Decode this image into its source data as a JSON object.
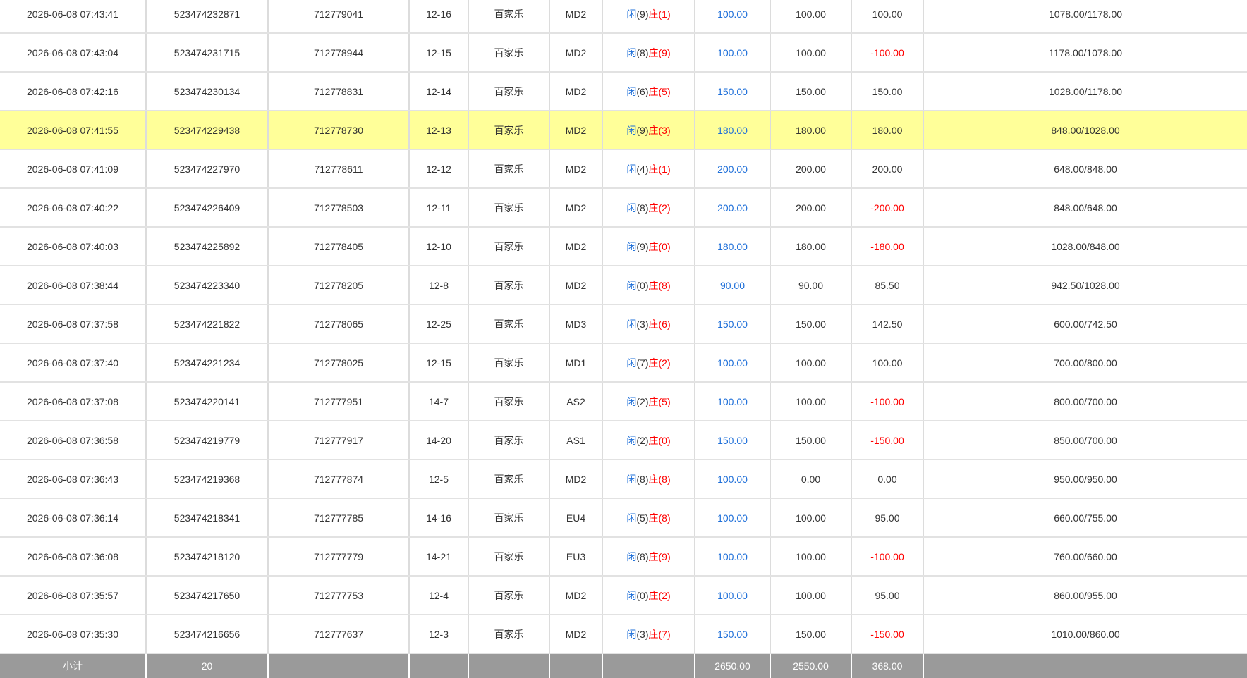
{
  "colors": {
    "highlight_row": "#ffff99",
    "blue_text": "#1e6fd9",
    "red_text": "#ff0000",
    "subtotal_bg": "#9a9a9a"
  },
  "rows": [
    {
      "time": "2026-06-08 07:43:41",
      "bet_id": "523474232871",
      "game_id": "712779041",
      "shoe": "12-16",
      "game": "百家乐",
      "table": "MD2",
      "player_label": "闲",
      "player_pts": "(9)",
      "banker_label": "庄",
      "banker_pts": "(1)",
      "bet": "100.00",
      "valid": "100.00",
      "win": "100.00",
      "win_negative": false,
      "balance": "1078.00/1178.00",
      "highlighted": false
    },
    {
      "time": "2026-06-08 07:43:04",
      "bet_id": "523474231715",
      "game_id": "712778944",
      "shoe": "12-15",
      "game": "百家乐",
      "table": "MD2",
      "player_label": "闲",
      "player_pts": "(8)",
      "banker_label": "庄",
      "banker_pts": "(9)",
      "bet": "100.00",
      "valid": "100.00",
      "win": "-100.00",
      "win_negative": true,
      "balance": "1178.00/1078.00",
      "highlighted": false
    },
    {
      "time": "2026-06-08 07:42:16",
      "bet_id": "523474230134",
      "game_id": "712778831",
      "shoe": "12-14",
      "game": "百家乐",
      "table": "MD2",
      "player_label": "闲",
      "player_pts": "(6)",
      "banker_label": "庄",
      "banker_pts": "(5)",
      "bet": "150.00",
      "valid": "150.00",
      "win": "150.00",
      "win_negative": false,
      "balance": "1028.00/1178.00",
      "highlighted": false
    },
    {
      "time": "2026-06-08 07:41:55",
      "bet_id": "523474229438",
      "game_id": "712778730",
      "shoe": "12-13",
      "game": "百家乐",
      "table": "MD2",
      "player_label": "闲",
      "player_pts": "(9)",
      "banker_label": "庄",
      "banker_pts": "(3)",
      "bet": "180.00",
      "valid": "180.00",
      "win": "180.00",
      "win_negative": false,
      "balance": "848.00/1028.00",
      "highlighted": true
    },
    {
      "time": "2026-06-08 07:41:09",
      "bet_id": "523474227970",
      "game_id": "712778611",
      "shoe": "12-12",
      "game": "百家乐",
      "table": "MD2",
      "player_label": "闲",
      "player_pts": "(4)",
      "banker_label": "庄",
      "banker_pts": "(1)",
      "bet": "200.00",
      "valid": "200.00",
      "win": "200.00",
      "win_negative": false,
      "balance": "648.00/848.00",
      "highlighted": false
    },
    {
      "time": "2026-06-08 07:40:22",
      "bet_id": "523474226409",
      "game_id": "712778503",
      "shoe": "12-11",
      "game": "百家乐",
      "table": "MD2",
      "player_label": "闲",
      "player_pts": "(8)",
      "banker_label": "庄",
      "banker_pts": "(2)",
      "bet": "200.00",
      "valid": "200.00",
      "win": "-200.00",
      "win_negative": true,
      "balance": "848.00/648.00",
      "highlighted": false
    },
    {
      "time": "2026-06-08 07:40:03",
      "bet_id": "523474225892",
      "game_id": "712778405",
      "shoe": "12-10",
      "game": "百家乐",
      "table": "MD2",
      "player_label": "闲",
      "player_pts": "(9)",
      "banker_label": "庄",
      "banker_pts": "(0)",
      "bet": "180.00",
      "valid": "180.00",
      "win": "-180.00",
      "win_negative": true,
      "balance": "1028.00/848.00",
      "highlighted": false
    },
    {
      "time": "2026-06-08 07:38:44",
      "bet_id": "523474223340",
      "game_id": "712778205",
      "shoe": "12-8",
      "game": "百家乐",
      "table": "MD2",
      "player_label": "闲",
      "player_pts": "(0)",
      "banker_label": "庄",
      "banker_pts": "(8)",
      "bet": "90.00",
      "valid": "90.00",
      "win": "85.50",
      "win_negative": false,
      "balance": "942.50/1028.00",
      "highlighted": false
    },
    {
      "time": "2026-06-08 07:37:58",
      "bet_id": "523474221822",
      "game_id": "712778065",
      "shoe": "12-25",
      "game": "百家乐",
      "table": "MD3",
      "player_label": "闲",
      "player_pts": "(3)",
      "banker_label": "庄",
      "banker_pts": "(6)",
      "bet": "150.00",
      "valid": "150.00",
      "win": "142.50",
      "win_negative": false,
      "balance": "600.00/742.50",
      "highlighted": false
    },
    {
      "time": "2026-06-08 07:37:40",
      "bet_id": "523474221234",
      "game_id": "712778025",
      "shoe": "12-15",
      "game": "百家乐",
      "table": "MD1",
      "player_label": "闲",
      "player_pts": "(7)",
      "banker_label": "庄",
      "banker_pts": "(2)",
      "bet": "100.00",
      "valid": "100.00",
      "win": "100.00",
      "win_negative": false,
      "balance": "700.00/800.00",
      "highlighted": false
    },
    {
      "time": "2026-06-08 07:37:08",
      "bet_id": "523474220141",
      "game_id": "712777951",
      "shoe": "14-7",
      "game": "百家乐",
      "table": "AS2",
      "player_label": "闲",
      "player_pts": "(2)",
      "banker_label": "庄",
      "banker_pts": "(5)",
      "bet": "100.00",
      "valid": "100.00",
      "win": "-100.00",
      "win_negative": true,
      "balance": "800.00/700.00",
      "highlighted": false
    },
    {
      "time": "2026-06-08 07:36:58",
      "bet_id": "523474219779",
      "game_id": "712777917",
      "shoe": "14-20",
      "game": "百家乐",
      "table": "AS1",
      "player_label": "闲",
      "player_pts": "(2)",
      "banker_label": "庄",
      "banker_pts": "(0)",
      "bet": "150.00",
      "valid": "150.00",
      "win": "-150.00",
      "win_negative": true,
      "balance": "850.00/700.00",
      "highlighted": false
    },
    {
      "time": "2026-06-08 07:36:43",
      "bet_id": "523474219368",
      "game_id": "712777874",
      "shoe": "12-5",
      "game": "百家乐",
      "table": "MD2",
      "player_label": "闲",
      "player_pts": "(8)",
      "banker_label": "庄",
      "banker_pts": "(8)",
      "bet": "100.00",
      "valid": "0.00",
      "win": "0.00",
      "win_negative": false,
      "balance": "950.00/950.00",
      "highlighted": false
    },
    {
      "time": "2026-06-08 07:36:14",
      "bet_id": "523474218341",
      "game_id": "712777785",
      "shoe": "14-16",
      "game": "百家乐",
      "table": "EU4",
      "player_label": "闲",
      "player_pts": "(5)",
      "banker_label": "庄",
      "banker_pts": "(8)",
      "bet": "100.00",
      "valid": "100.00",
      "win": "95.00",
      "win_negative": false,
      "balance": "660.00/755.00",
      "highlighted": false
    },
    {
      "time": "2026-06-08 07:36:08",
      "bet_id": "523474218120",
      "game_id": "712777779",
      "shoe": "14-21",
      "game": "百家乐",
      "table": "EU3",
      "player_label": "闲",
      "player_pts": "(8)",
      "banker_label": "庄",
      "banker_pts": "(9)",
      "bet": "100.00",
      "valid": "100.00",
      "win": "-100.00",
      "win_negative": true,
      "balance": "760.00/660.00",
      "highlighted": false
    },
    {
      "time": "2026-06-08 07:35:57",
      "bet_id": "523474217650",
      "game_id": "712777753",
      "shoe": "12-4",
      "game": "百家乐",
      "table": "MD2",
      "player_label": "闲",
      "player_pts": "(0)",
      "banker_label": "庄",
      "banker_pts": "(2)",
      "bet": "100.00",
      "valid": "100.00",
      "win": "95.00",
      "win_negative": false,
      "balance": "860.00/955.00",
      "highlighted": false
    },
    {
      "time": "2026-06-08 07:35:30",
      "bet_id": "523474216656",
      "game_id": "712777637",
      "shoe": "12-3",
      "game": "百家乐",
      "table": "MD2",
      "player_label": "闲",
      "player_pts": "(3)",
      "banker_label": "庄",
      "banker_pts": "(7)",
      "bet": "150.00",
      "valid": "150.00",
      "win": "-150.00",
      "win_negative": true,
      "balance": "1010.00/860.00",
      "highlighted": false
    }
  ],
  "subtotal": {
    "label": "小计",
    "count": "20",
    "bet_total": "2650.00",
    "valid_total": "2550.00",
    "win_total": "368.00"
  }
}
